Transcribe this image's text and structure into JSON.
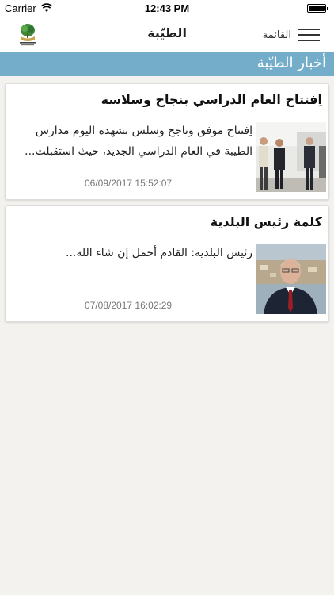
{
  "status_bar": {
    "carrier": "Carrier",
    "time": "12:43 PM"
  },
  "nav": {
    "title": "الطيّبة",
    "menu_label": "القائمة"
  },
  "section": {
    "title": "أخبار الطيّبة"
  },
  "articles": [
    {
      "title": "اِفتتاح العام الدراسي بنجاح وسلاسة",
      "excerpt": "اِفتتاح موفق وناجح وسلس تشهده اليوم مدارس الطيبة في العام الدراسي الجديد، حيث استقبلت...",
      "date": "06/09/2017 15:52:07"
    },
    {
      "title": "كلمة رئيس البلدية",
      "excerpt": "رئيس البلدية: القادم أجمل إن شاء الله...",
      "date": "07/08/2017 16:02:29"
    }
  ],
  "colors": {
    "section_header": "#74adc9",
    "background": "#f3f2ee"
  }
}
